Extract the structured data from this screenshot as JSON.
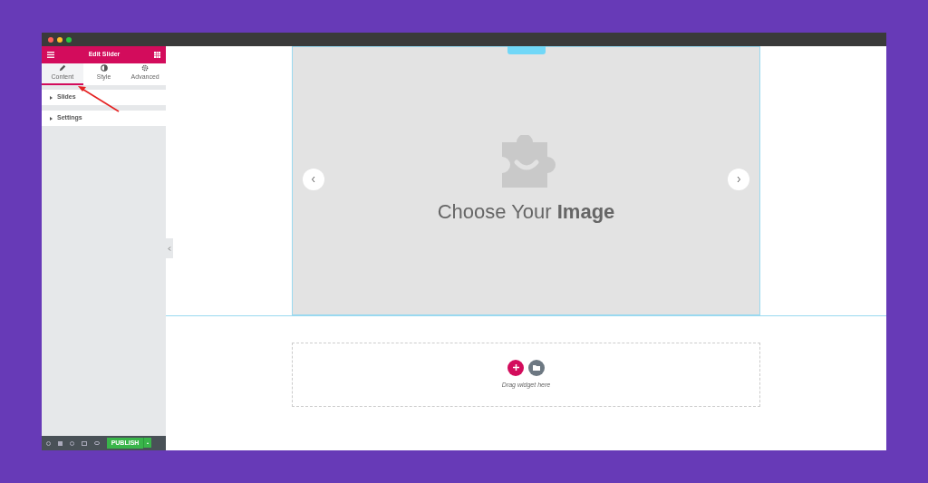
{
  "panel": {
    "title": "Edit Slider",
    "tabs": [
      {
        "label": "Content",
        "selected": true
      },
      {
        "label": "Style",
        "selected": false
      },
      {
        "label": "Advanced",
        "selected": false
      }
    ],
    "sections": [
      {
        "label": "Slides",
        "expanded": false
      },
      {
        "label": "Settings",
        "expanded": false
      }
    ],
    "footer": {
      "publish": "PUBLISH"
    }
  },
  "canvas": {
    "placeholder_text": "Choose Your **Image**",
    "drop_hint": "Drag widget here"
  }
}
